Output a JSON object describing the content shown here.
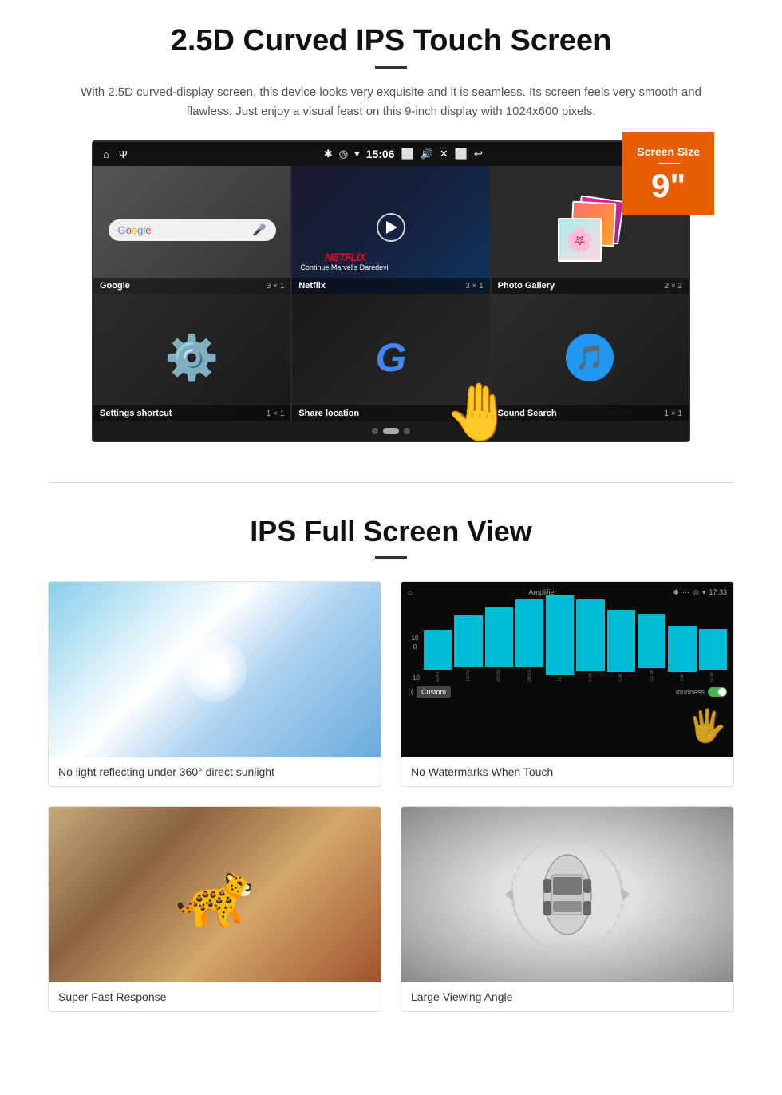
{
  "section1": {
    "title": "2.5D Curved IPS Touch Screen",
    "description": "With 2.5D curved-display screen, this device looks very exquisite and it is seamless. Its screen feels very smooth and flawless. Just enjoy a visual feast on this 9-inch display with 1024x600 pixels.",
    "badge": {
      "title": "Screen Size",
      "size": "9\""
    },
    "statusbar": {
      "time": "15:06"
    },
    "apps": [
      {
        "name": "Google",
        "size": "3 × 1"
      },
      {
        "name": "Netflix",
        "size": "3 × 1",
        "subtitle": "Continue Marvel's Daredevil"
      },
      {
        "name": "Photo Gallery",
        "size": "2 × 2"
      },
      {
        "name": "Settings shortcut",
        "size": "1 × 1"
      },
      {
        "name": "Share location",
        "size": "1 × 1"
      },
      {
        "name": "Sound Search",
        "size": "1 × 1"
      }
    ]
  },
  "section2": {
    "title": "IPS Full Screen View",
    "features": [
      {
        "caption": "No light reflecting under 360° direct sunlight"
      },
      {
        "caption": "No Watermarks When Touch"
      },
      {
        "caption": "Super Fast Response"
      },
      {
        "caption": "Large Viewing Angle"
      }
    ],
    "amplifier": {
      "title": "Amplifier",
      "eq_labels": [
        "60hz",
        "100hz",
        "200hz",
        "500hz",
        "1k",
        "2.5k",
        "10k",
        "12.5k",
        "15k",
        "SUB"
      ],
      "eq_heights": [
        50,
        65,
        75,
        90,
        110,
        95,
        80,
        70,
        60,
        55
      ],
      "custom_label": "Custom",
      "loudness_label": "loudness"
    }
  }
}
